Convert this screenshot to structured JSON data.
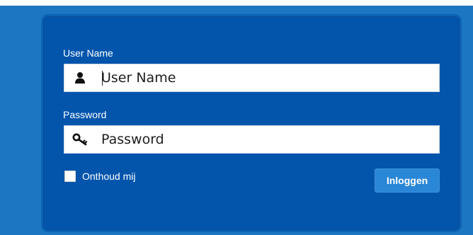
{
  "login_form": {
    "username": {
      "label": "User Name",
      "placeholder": "User Name",
      "value": "",
      "icon": "user-icon"
    },
    "password": {
      "label": "Password",
      "placeholder": "Password",
      "value": "",
      "icon": "key-icon"
    },
    "remember": {
      "label": "Onthoud mij",
      "checked": false
    },
    "submit_label": "Inloggen"
  },
  "colors": {
    "background": "#1c76c2",
    "panel": "#0355ac",
    "button": "#2a86d6",
    "text_light": "#ffffff"
  }
}
